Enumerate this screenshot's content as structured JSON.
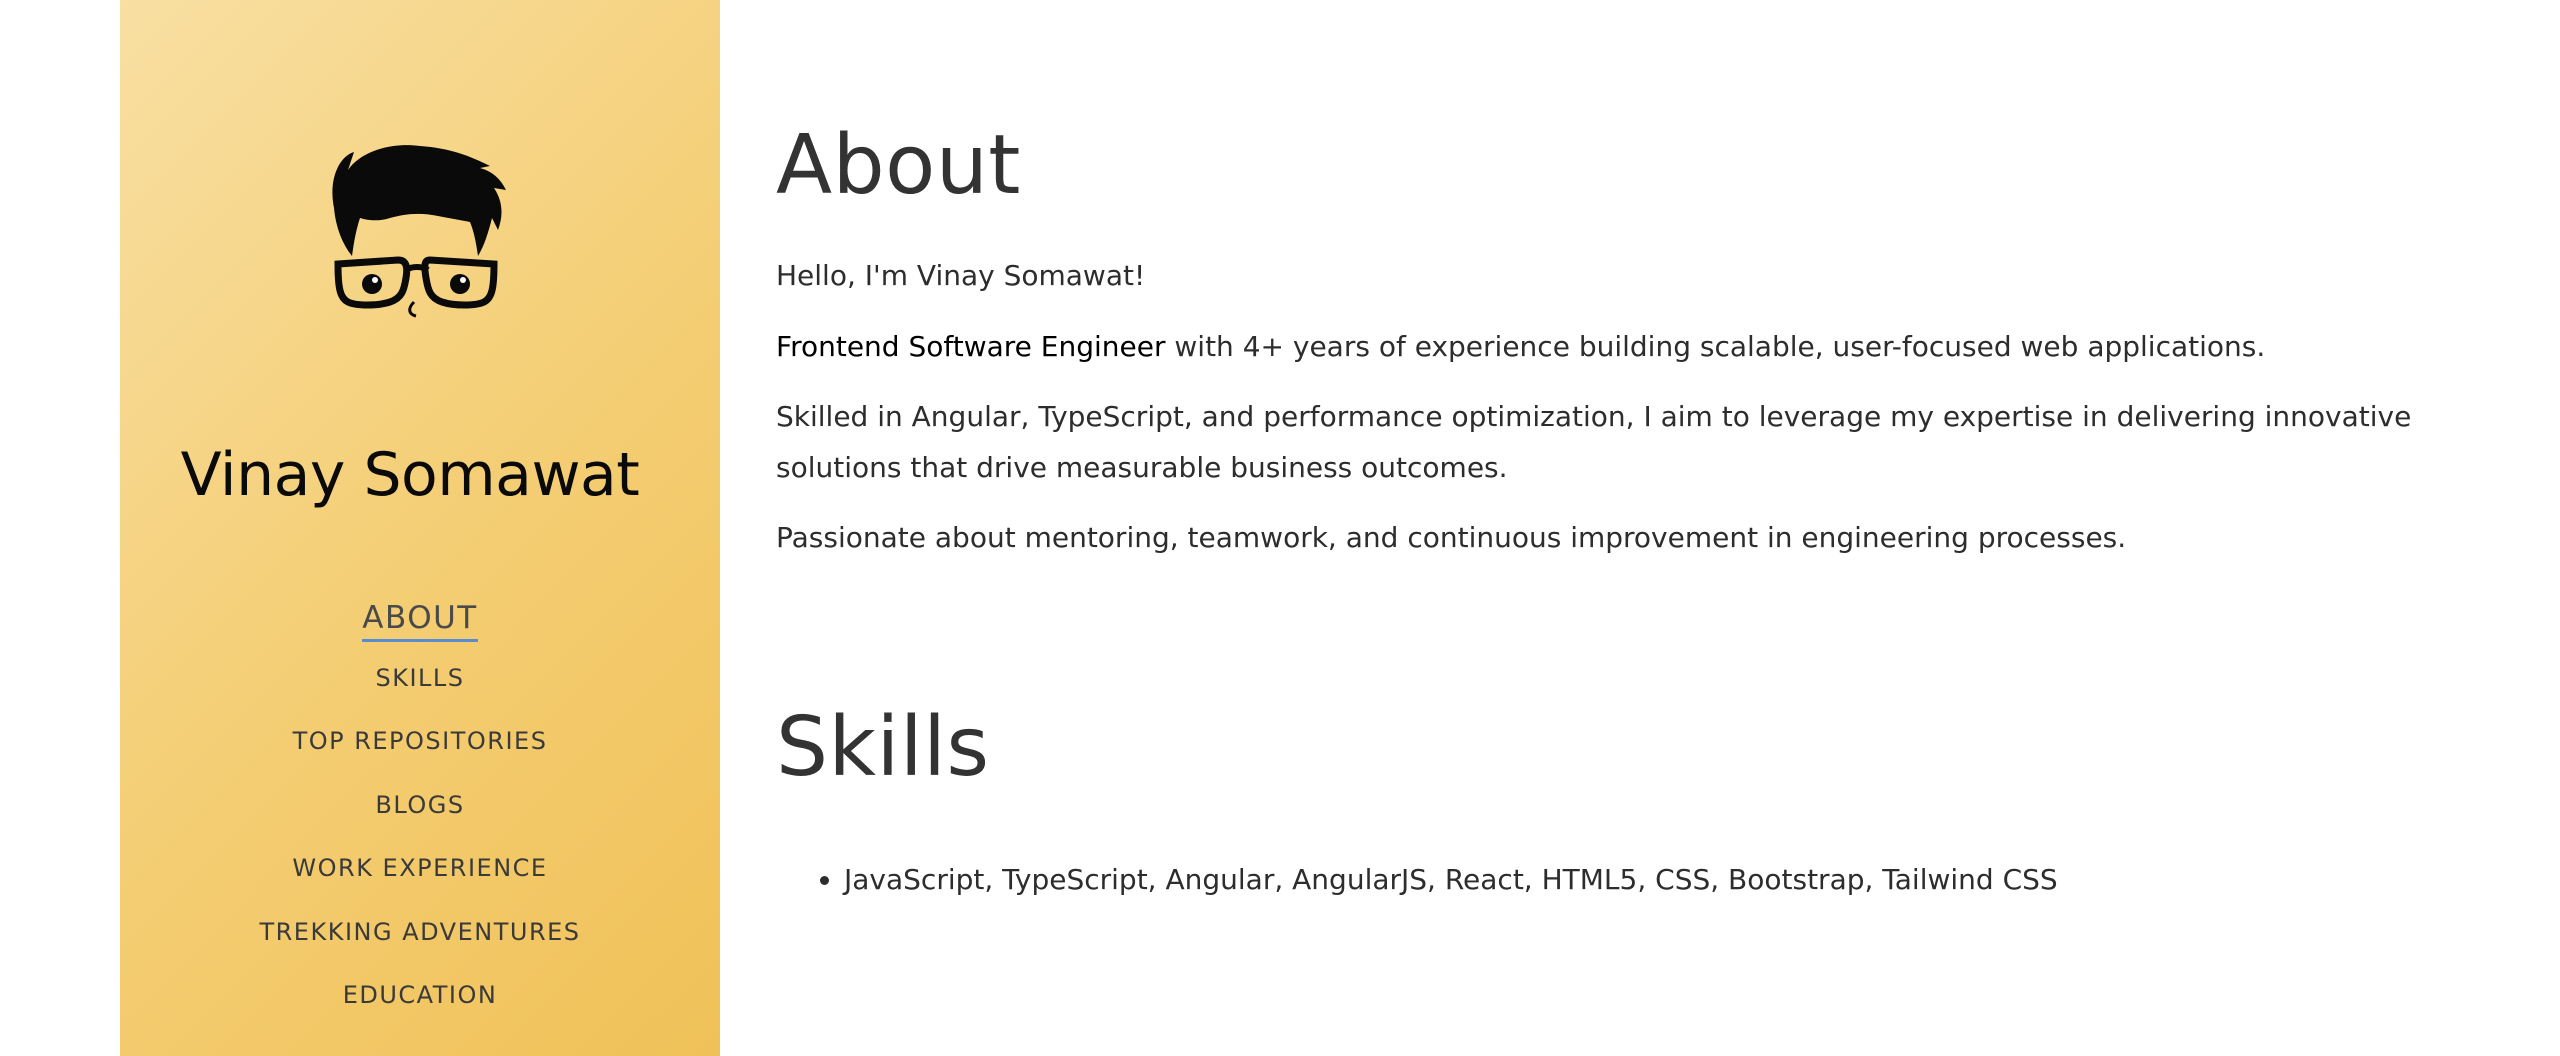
{
  "profile": {
    "name": "Vinay Somawat",
    "avatar_icon": "cartoon-face-with-glasses-icon"
  },
  "nav": {
    "items": [
      {
        "label": "ABOUT",
        "active": true
      },
      {
        "label": "SKILLS",
        "active": false
      },
      {
        "label": "TOP REPOSITORIES",
        "active": false
      },
      {
        "label": "BLOGS",
        "active": false
      },
      {
        "label": "WORK EXPERIENCE",
        "active": false
      },
      {
        "label": "TREKKING ADVENTURES",
        "active": false
      },
      {
        "label": "EDUCATION",
        "active": false
      }
    ]
  },
  "about": {
    "title": "About",
    "greeting": "Hello, I'm Vinay Somawat!",
    "role_bold": "Frontend Software Engineer",
    "role_rest": " with 4+ years of experience building scalable, user-focused web applications.",
    "skills_summary": "Skilled in Angular, TypeScript, and performance optimization, I aim to leverage my expertise in delivering innovative solutions that drive measurable business outcomes.",
    "passion": "Passionate about mentoring, teamwork, and continuous improvement in engineering processes."
  },
  "skills": {
    "title": "Skills",
    "items": [
      "JavaScript, TypeScript, Angular, AngularJS, React, HTML5, CSS, Bootstrap, Tailwind CSS"
    ]
  },
  "colors": {
    "sidebar_gradient_start": "#f8dfa2",
    "sidebar_gradient_end": "#f0c158",
    "active_underline": "#5b8bd0",
    "text": "#333333"
  }
}
